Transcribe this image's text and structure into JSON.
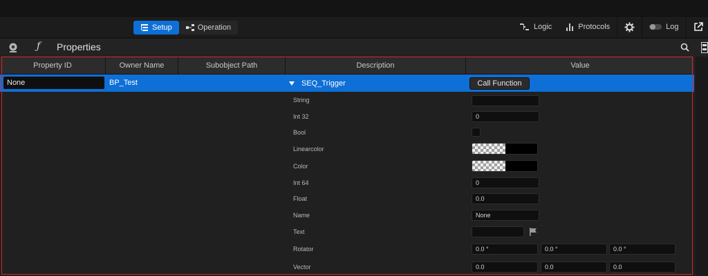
{
  "toolbar": {
    "modes": [
      {
        "label": "Setup",
        "active": true,
        "icon": "list-tree-icon"
      },
      {
        "label": "Operation",
        "active": false,
        "icon": "node-graph-icon"
      }
    ],
    "right": {
      "logic_label": "Logic",
      "protocols_label": "Protocols",
      "log_label": "Log"
    }
  },
  "panel": {
    "title": "Properties"
  },
  "table": {
    "columns": [
      "Property ID",
      "Owner Name",
      "Subobject Path",
      "Description",
      "Value"
    ],
    "selected_row": {
      "property_id": "None",
      "owner_name": "BP_Test",
      "description": "SEQ_Trigger",
      "value_button": "Call Function"
    },
    "params": [
      {
        "label": "String",
        "value": ""
      },
      {
        "label": "Int 32",
        "value": "0"
      },
      {
        "label": "Bool",
        "value": ""
      },
      {
        "label": "Linearcolor",
        "value": ""
      },
      {
        "label": "Color",
        "value": ""
      },
      {
        "label": "Int 64",
        "value": "0"
      },
      {
        "label": "Float",
        "value": "0.0"
      },
      {
        "label": "Name",
        "value": "None"
      },
      {
        "label": "Text",
        "value": ""
      },
      {
        "label": "Rotator",
        "values": [
          "0.0 °",
          "0.0 °",
          "0.0 °"
        ]
      },
      {
        "label": "Vector",
        "values": [
          "0.0",
          "0.0",
          "0.0"
        ]
      }
    ]
  },
  "colors": {
    "accent": "#0e6fd6",
    "highlight_frame": "#e0232b"
  }
}
